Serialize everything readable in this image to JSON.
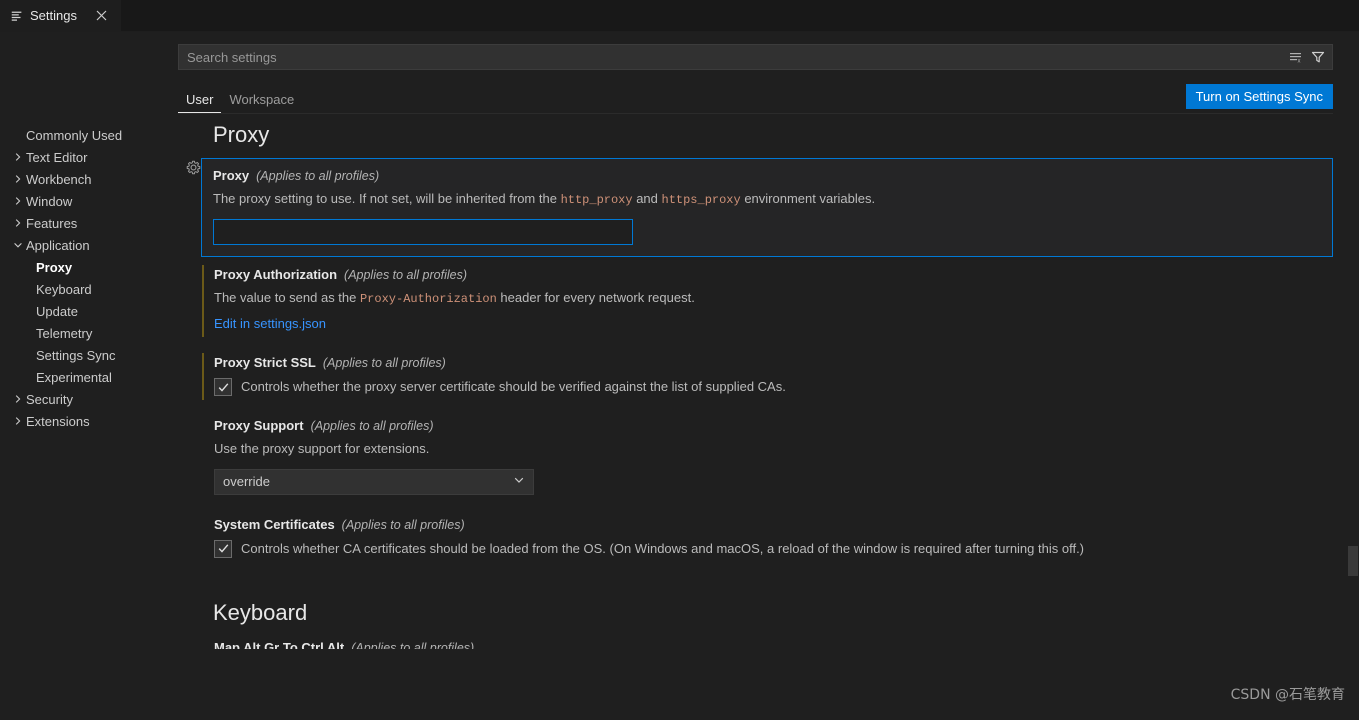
{
  "window": {
    "tab": {
      "label": "Settings",
      "icon": "settings-list-icon",
      "close_icon": "close-icon"
    }
  },
  "search": {
    "placeholder": "Search settings",
    "value": "",
    "clear_icon": "clear-search-results-icon",
    "filter_icon": "filter-funnel-icon"
  },
  "scope_tabs": [
    {
      "label": "User",
      "active": true
    },
    {
      "label": "Workspace",
      "active": false
    }
  ],
  "sync_button": {
    "label": "Turn on Settings Sync",
    "color": "#0078d4"
  },
  "toc": [
    {
      "label": "Commonly Used",
      "level": 0,
      "chevron": "none",
      "selected": false
    },
    {
      "label": "Text Editor",
      "level": 0,
      "chevron": "right",
      "selected": false
    },
    {
      "label": "Workbench",
      "level": 0,
      "chevron": "right",
      "selected": false
    },
    {
      "label": "Window",
      "level": 0,
      "chevron": "right",
      "selected": false
    },
    {
      "label": "Features",
      "level": 0,
      "chevron": "right",
      "selected": false
    },
    {
      "label": "Application",
      "level": 0,
      "chevron": "down",
      "selected": false
    },
    {
      "label": "Proxy",
      "level": 1,
      "chevron": "none",
      "selected": true
    },
    {
      "label": "Keyboard",
      "level": 1,
      "chevron": "none",
      "selected": false
    },
    {
      "label": "Update",
      "level": 1,
      "chevron": "none",
      "selected": false
    },
    {
      "label": "Telemetry",
      "level": 1,
      "chevron": "none",
      "selected": false
    },
    {
      "label": "Settings Sync",
      "level": 1,
      "chevron": "none",
      "selected": false
    },
    {
      "label": "Experimental",
      "level": 1,
      "chevron": "none",
      "selected": false
    },
    {
      "label": "Security",
      "level": 0,
      "chevron": "right",
      "selected": false
    },
    {
      "label": "Extensions",
      "level": 0,
      "chevron": "right",
      "selected": false
    }
  ],
  "sections": {
    "proxy_heading": "Proxy",
    "keyboard_heading": "Keyboard"
  },
  "settings": {
    "proxy": {
      "title": "Proxy",
      "profile_note": "(Applies to all profiles)",
      "desc_before": "The proxy setting to use. If not set, will be inherited from the ",
      "code_1": "http_proxy",
      "desc_mid": " and ",
      "code_2": "https_proxy",
      "desc_after": " environment variables.",
      "value": "",
      "gear_icon": "gear-icon"
    },
    "proxy_authorization": {
      "title": "Proxy Authorization",
      "profile_note": "(Applies to all profiles)",
      "desc_before": "The value to send as the ",
      "code_1": "Proxy-Authorization",
      "desc_after": " header for every network request.",
      "link": "Edit in settings.json"
    },
    "proxy_strict_ssl": {
      "title": "Proxy Strict SSL",
      "profile_note": "(Applies to all profiles)",
      "checkbox_label": "Controls whether the proxy server certificate should be verified against the list of supplied CAs.",
      "checked": true
    },
    "proxy_support": {
      "title": "Proxy Support",
      "profile_note": "(Applies to all profiles)",
      "desc": "Use the proxy support for extensions.",
      "selected": "override",
      "chevron_icon": "chevron-down-icon"
    },
    "system_certificates": {
      "title": "System Certificates",
      "profile_note": "(Applies to all profiles)",
      "checkbox_label": "Controls whether CA certificates should be loaded from the OS. (On Windows and macOS, a reload of the window is required after turning this off.)",
      "checked": true
    },
    "map_alt_gr": {
      "title": "Map Alt Gr To Ctrl Alt",
      "profile_note": "(Applies to all profiles)"
    }
  },
  "watermark": "CSDN @石笔教育"
}
